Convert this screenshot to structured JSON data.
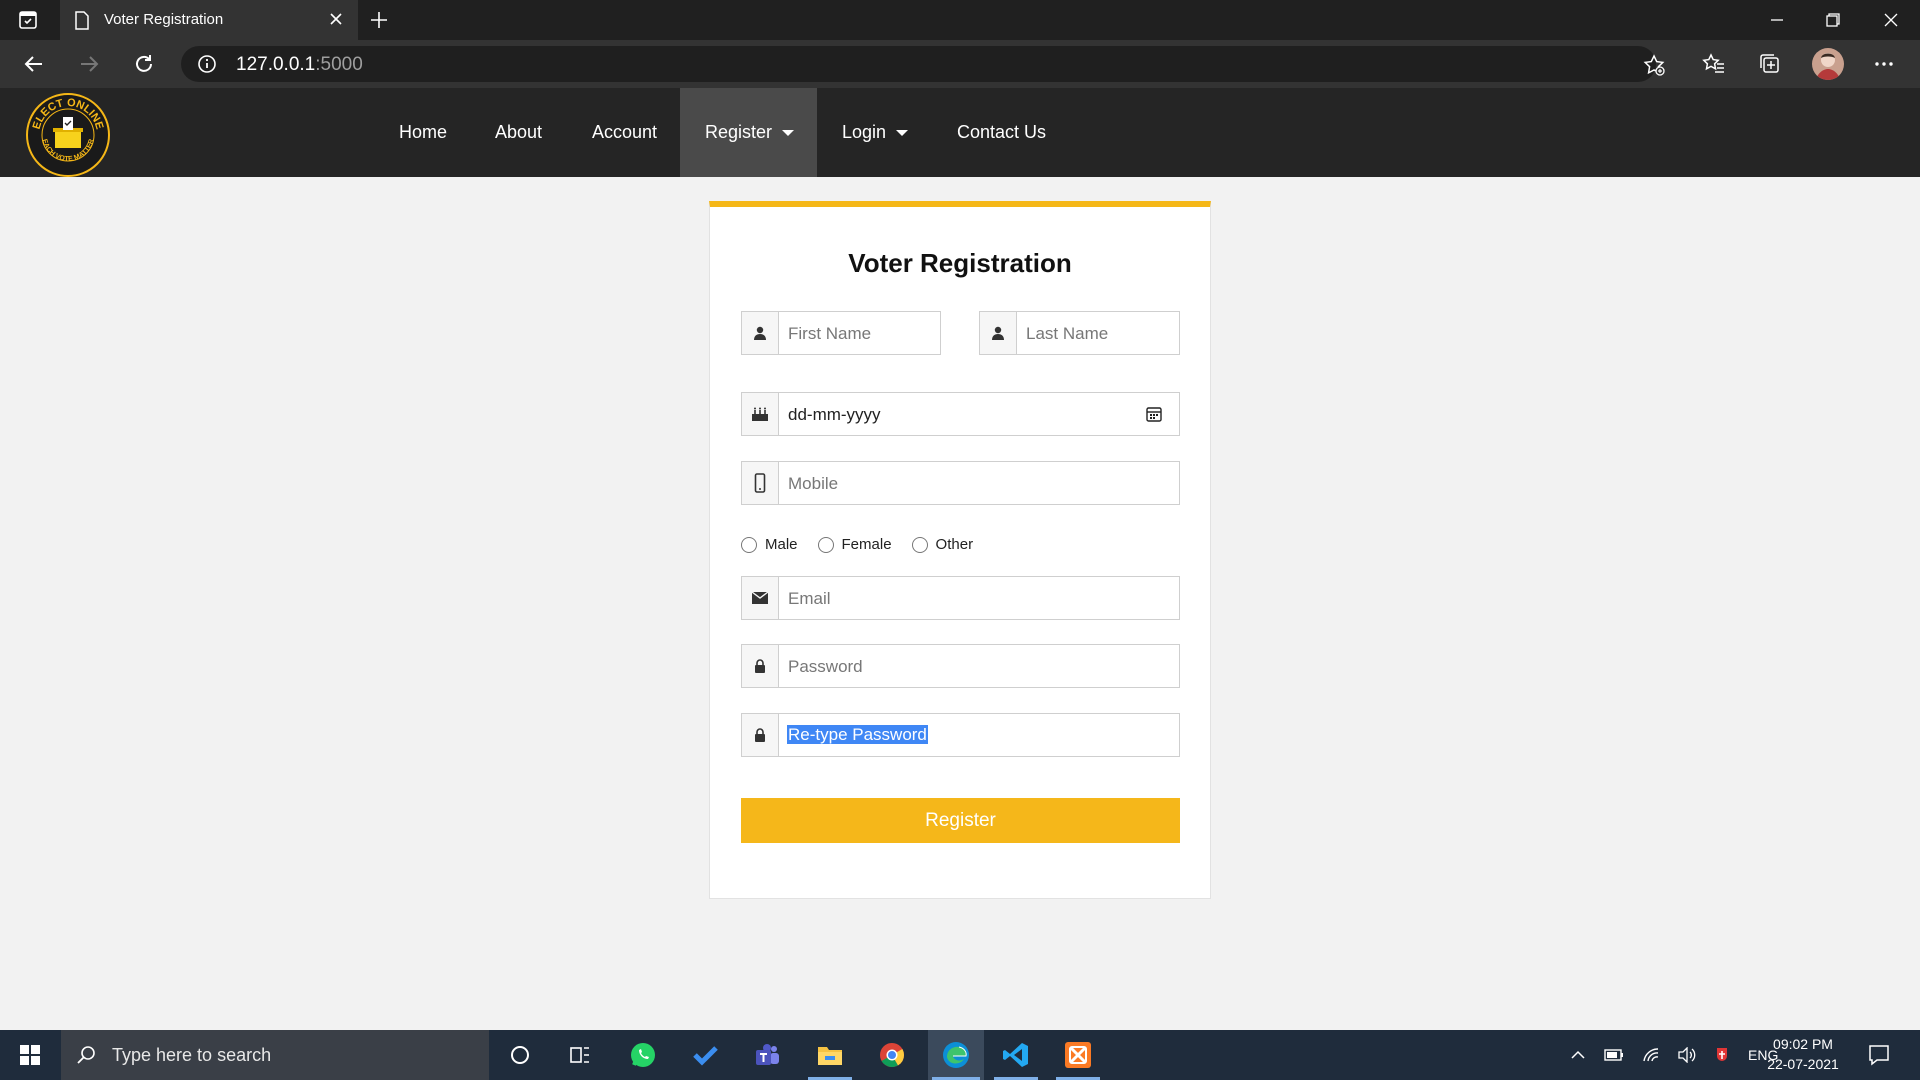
{
  "browser": {
    "tab_title": "Voter Registration",
    "url_host": "127.0.0.1",
    "url_port": ":5000"
  },
  "site": {
    "logo_alt": "ELECT ONLINE - EACH VOTE MATTER",
    "logo_top_text": "ELECT ONLINE",
    "logo_bottom_text": "EACH VOTE MATTER",
    "nav": [
      {
        "label": "Home"
      },
      {
        "label": "About"
      },
      {
        "label": "Account"
      },
      {
        "label": "Register"
      },
      {
        "label": "Login"
      },
      {
        "label": "Contact Us"
      }
    ]
  },
  "form": {
    "title": "Voter Registration",
    "first_name_placeholder": "First Name",
    "last_name_placeholder": "Last Name",
    "dob_value": "dd-mm-yyyy",
    "mobile_placeholder": "Mobile",
    "gender_options": [
      "Male",
      "Female",
      "Other"
    ],
    "email_placeholder": "Email",
    "password_placeholder": "Password",
    "retype_password_value": "Re-type Password",
    "register_button": "Register"
  },
  "taskbar": {
    "search_placeholder": "Type here to search",
    "language": "ENG",
    "time": "09:02 PM",
    "date": "22-07-2021"
  },
  "colors": {
    "accent": "#f5b717",
    "nav_bg": "#252525",
    "selection": "#3f87f5"
  }
}
